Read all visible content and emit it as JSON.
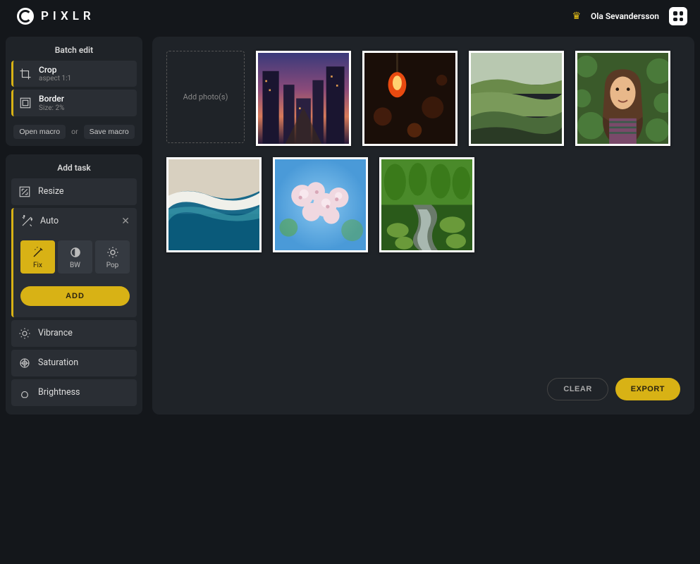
{
  "header": {
    "brand": "PIXLR",
    "username": "Ola Sevandersson"
  },
  "batch_panel": {
    "title": "Batch edit",
    "tasks": [
      {
        "name": "Crop",
        "sub": "aspect 1:1",
        "icon": "crop-icon"
      },
      {
        "name": "Border",
        "sub": "Size: 2%",
        "icon": "border-icon"
      }
    ],
    "open_macro": "Open macro",
    "or": "or",
    "save_macro": "Save macro"
  },
  "add_task_panel": {
    "title": "Add task",
    "items": [
      {
        "name": "Resize",
        "icon": "resize-icon"
      }
    ],
    "auto": {
      "label": "Auto",
      "options": [
        {
          "label": "Fix",
          "active": true
        },
        {
          "label": "BW",
          "active": false
        },
        {
          "label": "Pop",
          "active": false
        }
      ]
    },
    "add_button": "ADD",
    "more_items": [
      {
        "name": "Vibrance",
        "icon": "vibrance-icon"
      },
      {
        "name": "Saturation",
        "icon": "saturation-icon"
      },
      {
        "name": "Brightness",
        "icon": "brightness-icon"
      }
    ]
  },
  "content": {
    "add_label": "Add photo(s)",
    "clear": "CLEAR",
    "export": "EXPORT"
  }
}
